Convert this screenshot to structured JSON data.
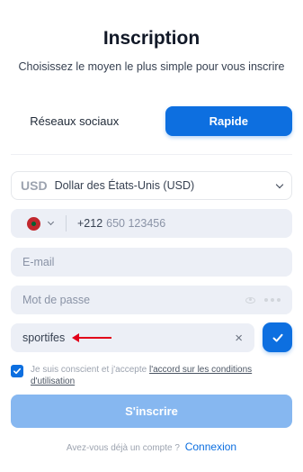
{
  "header": {
    "title": "Inscription",
    "subtitle": "Choisissez le moyen le plus simple pour vous inscrire"
  },
  "tabs": [
    {
      "label": "Réseaux sociaux",
      "active": false
    },
    {
      "label": "Rapide",
      "active": true
    }
  ],
  "currency": {
    "code": "USD",
    "name": "Dollar des États-Unis (USD)"
  },
  "phone": {
    "country_flag": "morocco-flag",
    "prefix": "+212",
    "placeholder": "650 123456"
  },
  "email": {
    "placeholder": "E-mail"
  },
  "password": {
    "placeholder": "Mot de passe"
  },
  "promo": {
    "value": "sportifes",
    "clear_label": "×"
  },
  "terms": {
    "checked": true,
    "text": "Je suis conscient et j'accepte",
    "link": "l'accord sur les conditions d'utilisation"
  },
  "submit_label": "S'inscrire",
  "login": {
    "prompt": "Avez-vous déjà un compte ?",
    "link": "Connexion"
  },
  "colors": {
    "accent": "#0d6fe0",
    "submit_disabled": "#86b7f0",
    "annotation_arrow": "#e2001a"
  }
}
